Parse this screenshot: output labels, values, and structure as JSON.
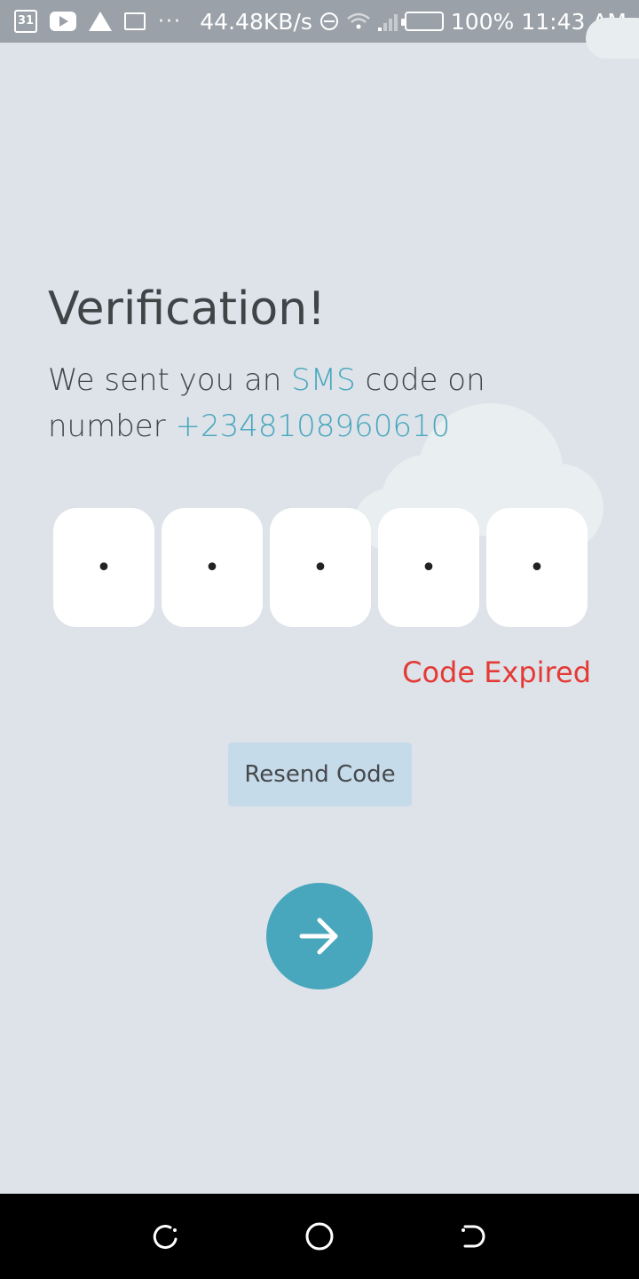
{
  "status_bar": {
    "calendar_day": "31",
    "network_speed": "44.48KB/s",
    "battery": "100%",
    "time": "11:43 AM",
    "icons": [
      "calendar-icon",
      "youtube-icon",
      "warning-icon",
      "cast-icon",
      "more-icon",
      "data-saver-icon",
      "wifi-icon",
      "signal-icon",
      "battery-icon"
    ]
  },
  "verification": {
    "title": "Verification!",
    "subtitle_part1": "We sent you an ",
    "subtitle_sms": "SMS",
    "subtitle_part2": " code on number ",
    "phone_number": "+2348108960610"
  },
  "code_inputs": [
    {
      "placeholder": "•"
    },
    {
      "placeholder": "•"
    },
    {
      "placeholder": "•"
    },
    {
      "placeholder": "•"
    },
    {
      "placeholder": "•"
    }
  ],
  "status_message": "Code Expired",
  "resend_label": "Resend Code",
  "next_icon": "arrow-right-icon",
  "colors": {
    "accent": "#48a6bd",
    "error": "#e53935",
    "background": "#dde3e9",
    "resend_bg": "#c6dbea"
  },
  "nav_bar": {
    "icons": [
      "recent-apps-icon",
      "home-icon",
      "back-icon"
    ]
  }
}
